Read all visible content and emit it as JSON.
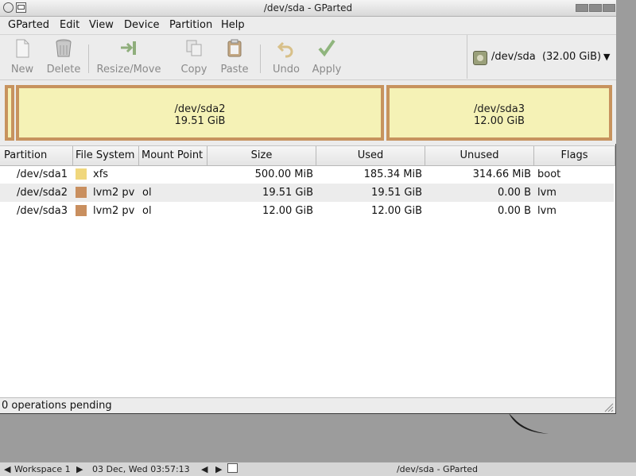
{
  "window": {
    "title": "/dev/sda - GParted"
  },
  "menubar": [
    {
      "label": "GParted"
    },
    {
      "label": "Edit"
    },
    {
      "label": "View"
    },
    {
      "label": "Device"
    },
    {
      "label": "Partition"
    },
    {
      "label": "Help"
    }
  ],
  "toolbar": {
    "new": "New",
    "delete": "Delete",
    "resize_move": "Resize/Move",
    "copy": "Copy",
    "paste": "Paste",
    "undo": "Undo",
    "apply": "Apply"
  },
  "device_selector": {
    "device": "/dev/sda",
    "size": "(32.00 GiB)"
  },
  "disk_map": {
    "sda2": {
      "name": "/dev/sda2",
      "size": "19.51 GiB"
    },
    "sda3": {
      "name": "/dev/sda3",
      "size": "12.00 GiB"
    }
  },
  "table": {
    "headers": {
      "partition": "Partition",
      "filesystem": "File System",
      "mount_point": "Mount Point",
      "size": "Size",
      "used": "Used",
      "unused": "Unused",
      "flags": "Flags"
    },
    "rows": [
      {
        "partition": "/dev/sda1",
        "filesystem": "xfs",
        "fs_color": "#f0d77d",
        "mount_point": "",
        "size": "500.00 MiB",
        "used": "185.34 MiB",
        "unused": "314.66 MiB",
        "flags": "boot"
      },
      {
        "partition": "/dev/sda2",
        "filesystem": "lvm2 pv",
        "fs_color": "#c98f5f",
        "mount_point": "ol",
        "size": "19.51 GiB",
        "used": "19.51 GiB",
        "unused": "0.00 B",
        "flags": "lvm"
      },
      {
        "partition": "/dev/sda3",
        "filesystem": "lvm2 pv",
        "fs_color": "#c98f5f",
        "mount_point": "ol",
        "size": "12.00 GiB",
        "used": "12.00 GiB",
        "unused": "0.00 B",
        "flags": "lvm"
      }
    ]
  },
  "status": {
    "text": "0 operations pending"
  },
  "taskbar": {
    "workspace": "Workspace 1",
    "clock": "03 Dec, Wed 03:57:13",
    "task": "/dev/sda - GParted"
  },
  "colors": {
    "partition_border": "#c7935e",
    "partition_fill": "#f5f2b6",
    "lvm_swatch": "#c98f5f",
    "xfs_swatch": "#f0d77d"
  }
}
